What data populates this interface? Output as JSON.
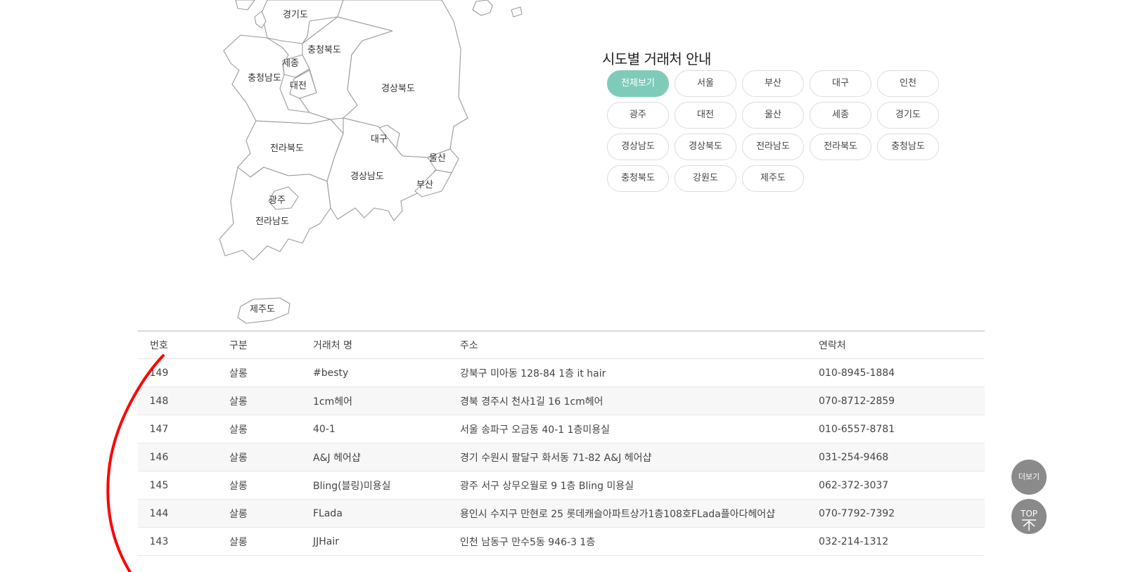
{
  "map": {
    "regions": [
      "경기도",
      "충청북도",
      "세종",
      "충청남도",
      "대전",
      "경상북도",
      "대구",
      "울산",
      "전라북도",
      "경상남도",
      "부산",
      "광주",
      "전라남도",
      "제주도"
    ]
  },
  "region_section": {
    "title": "시도별 거래처 안내",
    "buttons": [
      "전체보기",
      "서울",
      "부산",
      "대구",
      "인천",
      "광주",
      "대전",
      "울산",
      "세종",
      "경기도",
      "경상남도",
      "경상북도",
      "전라남도",
      "전라북도",
      "충청남도",
      "충청북도",
      "강원도",
      "제주도"
    ],
    "active": "전체보기",
    "accent_color": "#7fcbb9"
  },
  "table": {
    "headers": [
      "번호",
      "구분",
      "거래처 명",
      "주소",
      "연락처"
    ],
    "rows": [
      [
        "149",
        "살롱",
        "#besty",
        "강북구 미아동 128-84 1층 it hair",
        "010-8945-1884"
      ],
      [
        "148",
        "살롱",
        "1cm헤어",
        "경북 경주시 천사1길 16 1cm헤어",
        "070-8712-2859"
      ],
      [
        "147",
        "살롱",
        "40-1",
        "서울 송파구 오금동 40-1 1층미용실",
        "010-6557-8781"
      ],
      [
        "146",
        "살롱",
        "A&J 헤어샵",
        "경기 수원시 팔달구 화서동 71-82 A&J 헤어샵",
        "031-254-9468"
      ],
      [
        "145",
        "살롱",
        "Bling(블링)미용실",
        "광주 서구 상무오월로 9 1층 Bling 미용실",
        "062-372-3037"
      ],
      [
        "144",
        "살롱",
        "FLada",
        "용인시 수지구 만현로 25 롯데캐슬아파트상가1층108호FLada플아다헤어샵",
        "070-7792-7392"
      ],
      [
        "143",
        "살롱",
        "JJHair",
        "인천 남동구 만수5동 946-3 1층",
        "032-214-1312"
      ]
    ]
  },
  "floating": {
    "more_label": "더보기",
    "top_label": "TOP"
  },
  "annotation_color": "#ff0000"
}
